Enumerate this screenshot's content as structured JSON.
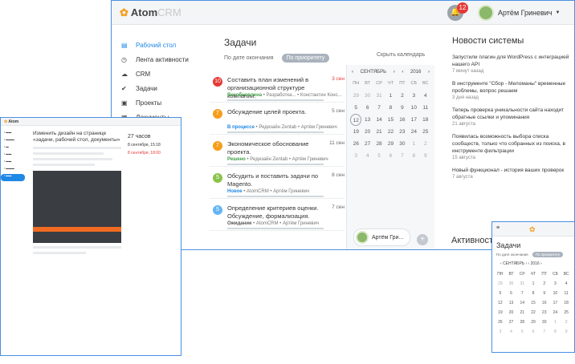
{
  "main": {
    "logo": {
      "name": "Atom",
      "suffix": "CRM"
    },
    "notifications": {
      "count": "12"
    },
    "user": {
      "name": "Артём Гриневич"
    },
    "nav": [
      {
        "label": "Рабочий стол",
        "icon": "home-icon"
      },
      {
        "label": "Лента активности",
        "icon": "clock-icon"
      },
      {
        "label": "CRM",
        "icon": "cloud-icon"
      },
      {
        "label": "Задачи",
        "icon": "tasks-icon"
      },
      {
        "label": "Проекты",
        "icon": "briefcase-icon"
      },
      {
        "label": "Документы",
        "icon": "document-icon"
      }
    ],
    "tasks": {
      "title": "Задачи",
      "tab_deadline": "По дате окончания",
      "tab_priority": "По приоритету",
      "items": [
        {
          "num": "10",
          "color": "#e53935",
          "title": "Составить план изменений в организационной структуре компании.",
          "date": "3 сен",
          "date_red": true,
          "status": "Возобновлена",
          "status_color": "#43a047",
          "meta": "•  Разработка...  •  Константин Конс..."
        },
        {
          "num": "7",
          "color": "#f59e1b",
          "title": "Обсуждение целей проекта.",
          "date": "5 сен",
          "date_red": false,
          "status": "В процессе",
          "status_color": "#1e88e5",
          "meta": "•  Редизайн Zentab  •  Артём Гриневич"
        },
        {
          "num": "7",
          "color": "#f59e1b",
          "title": "Экономическое обоснование проекта.",
          "date": "11 сен",
          "date_red": false,
          "status": "Решено",
          "status_color": "#43a047",
          "meta": "•  Редизайн Zentab  •  Артём Гриневич"
        },
        {
          "num": "5",
          "color": "#8bc34a",
          "title": "Обсудить и поставить задачи по Magento.",
          "date": "8 сен",
          "date_red": false,
          "status": "Новое",
          "status_color": "#1e88e5",
          "meta": "•  AtomCRM  •  Артём Гриневич"
        },
        {
          "num": "5",
          "color": "#64b5f6",
          "title": "Определение критериев оценки. Обсуждение, формализация.",
          "date": "7 сен",
          "date_red": false,
          "status": "Ожидание",
          "status_color": "#555555",
          "meta": "•  AtomCRM  •  Артём Гриневич"
        }
      ]
    },
    "calendar": {
      "hide_label": "Скрыть календарь",
      "month": "СЕНТЯБРЬ",
      "year": "2016",
      "weekdays": [
        "ПН",
        "ВТ",
        "СР",
        "ЧТ",
        "ПТ",
        "СБ",
        "ВС"
      ],
      "days": [
        "29",
        "30",
        "31",
        "1",
        "2",
        "3",
        "4",
        "5",
        "6",
        "7",
        "8",
        "9",
        "10",
        "11",
        "12",
        "13",
        "14",
        "15",
        "16",
        "17",
        "18",
        "19",
        "20",
        "21",
        "22",
        "23",
        "24",
        "25",
        "26",
        "27",
        "28",
        "29",
        "30",
        "1",
        "2",
        "3",
        "4",
        "5",
        "6",
        "7",
        "8",
        "9"
      ],
      "footer_user": "Артём Гри...",
      "add_label": "+"
    },
    "news": {
      "title": "Новости системы",
      "items": [
        {
          "text": "Запустили плагин для WordPress с интеграцией нашего API",
          "date": "7 минут назад"
        },
        {
          "text": "В инструменте \"Сбор - Меломаны\" временные проблемы, вопрос решаем",
          "date": "3 дня назад"
        },
        {
          "text": "Теперь проверка уникальности сайта находит обратные ссылки и упоминания",
          "date": "21 августа"
        },
        {
          "text": "Появилась возможность выбора списка сообществ, только что собранных из поиска, в инструменте фильтрации",
          "date": "15 августа"
        },
        {
          "text": "Новый функционал - история ваших проверок",
          "date": "7 августа"
        }
      ]
    },
    "activity_title": "Активност"
  },
  "detail": {
    "logo": "Atom",
    "heading": "Изменить дизайн на странице «задачи, рабочий стол, документы»",
    "time_label": "27 часов",
    "date_a": "8 сентября, 15:18",
    "date_b": "8 сентября, 18:00"
  },
  "mobile": {
    "title": "Задачи",
    "tab_deadline": "По дате окончания",
    "tab_priority": "По приоритету",
    "month": "СЕНТЯБРЬ",
    "year": "2016"
  }
}
